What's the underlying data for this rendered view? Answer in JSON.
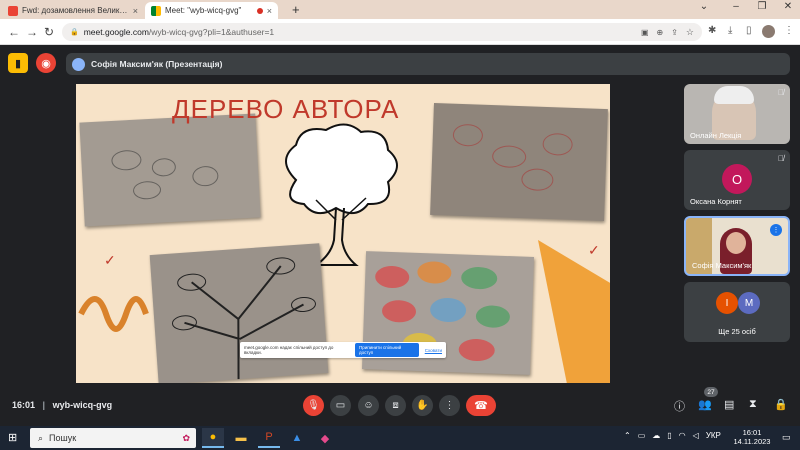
{
  "browser": {
    "tabs": [
      {
        "title": "Fwd: дозамовлення Великі Бр",
        "close": "×"
      },
      {
        "title": "Meet: \"wyb-wicq-gvg\"",
        "close": "×"
      }
    ],
    "new_tab": "+",
    "window_controls": {
      "chevron": "⌄",
      "minimize": "–",
      "maximize": "❐",
      "close": "✕"
    },
    "nav": {
      "back": "←",
      "forward": "→",
      "reload": "↻"
    },
    "url_host": "meet.google.com",
    "url_path": "/wyb-wicq-gvg?pli=1&authuser=1"
  },
  "meet": {
    "presenter": "Софія Максим'як (Презентація)",
    "slide": {
      "title": "ДЕРЕВО АВТОРА",
      "share_banner": {
        "text": "meet.google.com надає спільний доступ до вкладки.",
        "button": "Припинити спільний доступ",
        "link": "Сховати"
      }
    },
    "participants": [
      {
        "name": "Онлайн Лекція",
        "muted": true
      },
      {
        "name": "Оксана Корнят",
        "initial": "О",
        "color": "#c2185b",
        "muted": true
      },
      {
        "name": "Софія Максим'як",
        "speaking": true
      },
      {
        "name": "Ще 25 осіб",
        "initials": [
          "І",
          "М"
        ],
        "colors": [
          "#e65100",
          "#5c6bc0"
        ]
      }
    ],
    "meeting_info": {
      "time": "16:01",
      "separator": "|",
      "code": "wyb-wicq-gvg"
    },
    "people_count": "27"
  },
  "taskbar": {
    "search_placeholder": "Пошук",
    "language": "УКР",
    "time": "16:01",
    "date": "14.11.2023"
  }
}
